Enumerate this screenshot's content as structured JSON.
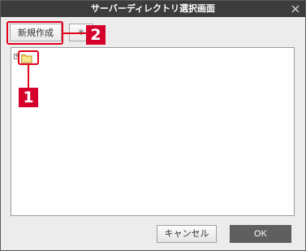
{
  "window": {
    "title": "サーバーディレクトリ選択画面"
  },
  "toolbar": {
    "new_label": "新規作成",
    "second_label": "※"
  },
  "annotations": {
    "badge_1": "1",
    "badge_2": "2"
  },
  "tree": {
    "expander_symbol": "+",
    "root_icon": "folder-icon"
  },
  "footer": {
    "cancel_label": "キャンセル",
    "ok_label": "OK"
  },
  "colors": {
    "titlebar": "#3c3c3c",
    "annotation_red": "#e2001a",
    "ok_button": "#5f5f5f",
    "folder": "#f4d35e"
  }
}
